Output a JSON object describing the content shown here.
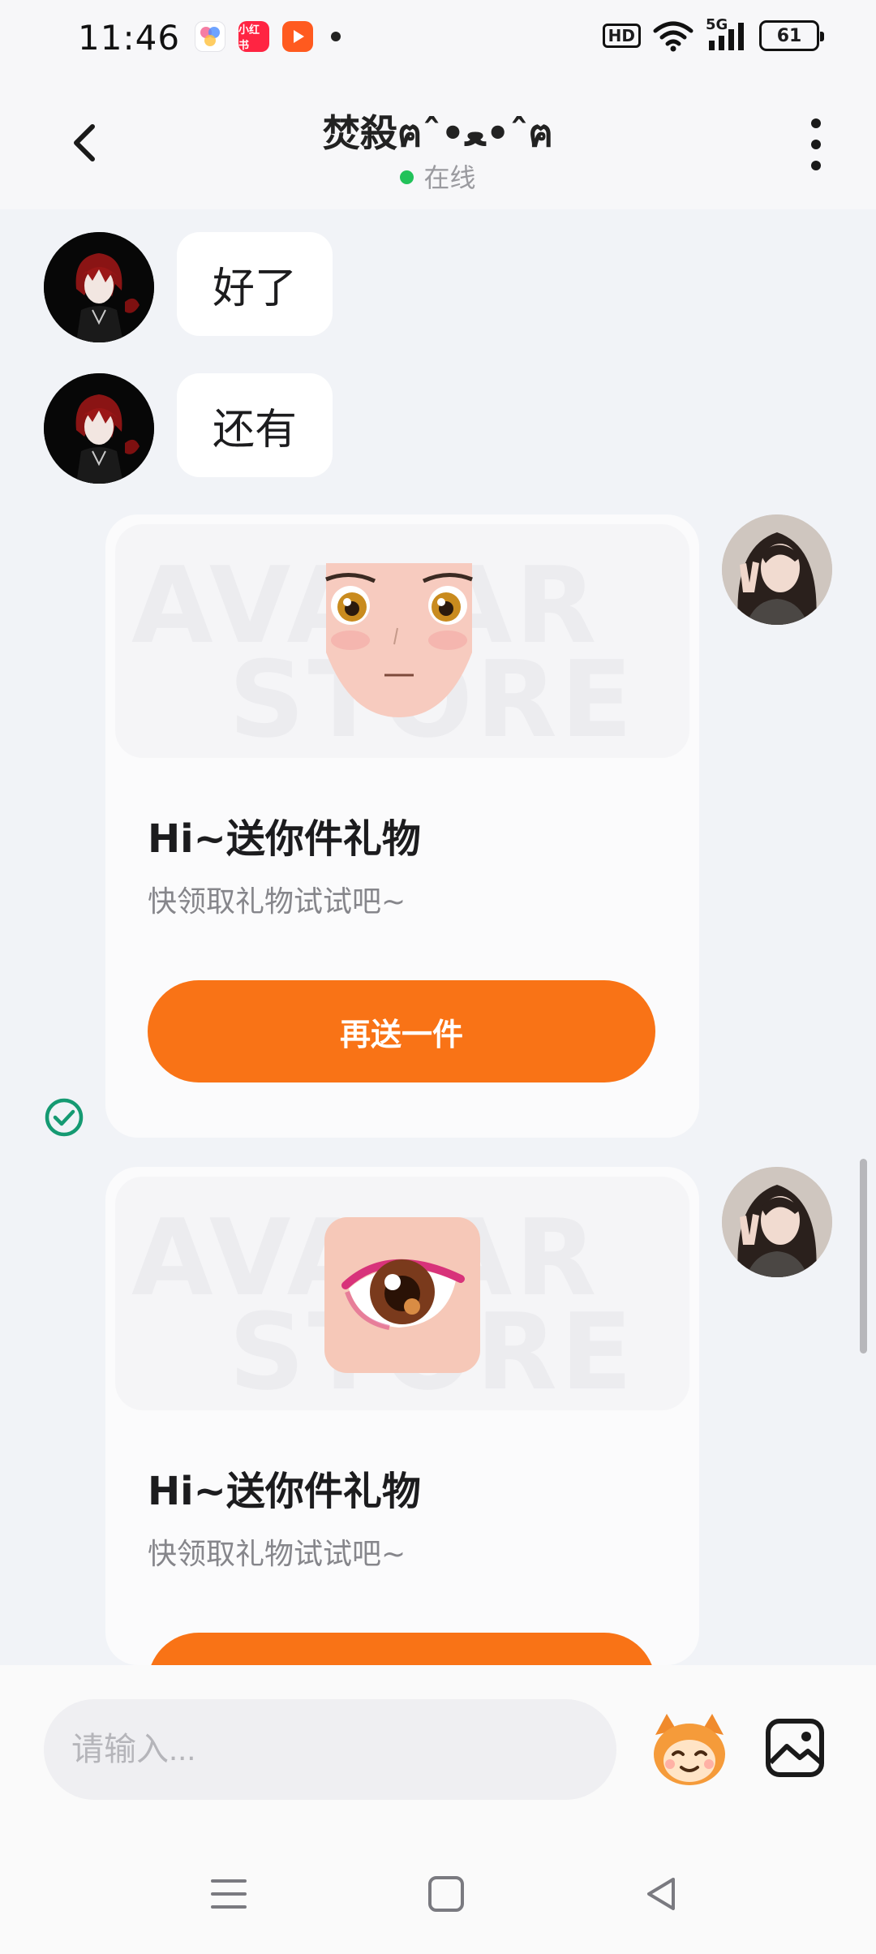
{
  "status_bar": {
    "time": "11:46",
    "apps": [
      {
        "icon": "photos-app-icon",
        "color": "#ffffff"
      },
      {
        "icon": "xiaohongshu-app-icon",
        "label": "小红书",
        "color": "#ff2442"
      },
      {
        "icon": "video-app-icon",
        "color": "#ff5a1f"
      }
    ],
    "hd_label": "HD",
    "network_label": "5G",
    "battery": "61"
  },
  "header": {
    "title": "焚殺ฅˆ•ﻌ•ˆฅ",
    "status": "在线"
  },
  "messages": [
    {
      "sender": "other",
      "text": "好了"
    },
    {
      "sender": "other",
      "text": "还有"
    },
    {
      "sender": "me",
      "type": "gift_card",
      "image": "anime-face-gift",
      "watermark": [
        "AVATAR",
        "STORE"
      ],
      "title": "Hi~送你件礼物",
      "subtitle": "快领取礼物试试吧~",
      "button": "再送一件",
      "delivered": true
    },
    {
      "sender": "me",
      "type": "gift_card",
      "image": "anime-eye-gift",
      "watermark": [
        "AVATAR",
        "STORE"
      ],
      "title": "Hi~送你件礼物",
      "subtitle": "快领取礼物试试吧~"
    }
  ],
  "input": {
    "placeholder": "请输入..."
  },
  "colors": {
    "accent": "#f97316",
    "online": "#22c25a",
    "check": "#159a72"
  }
}
